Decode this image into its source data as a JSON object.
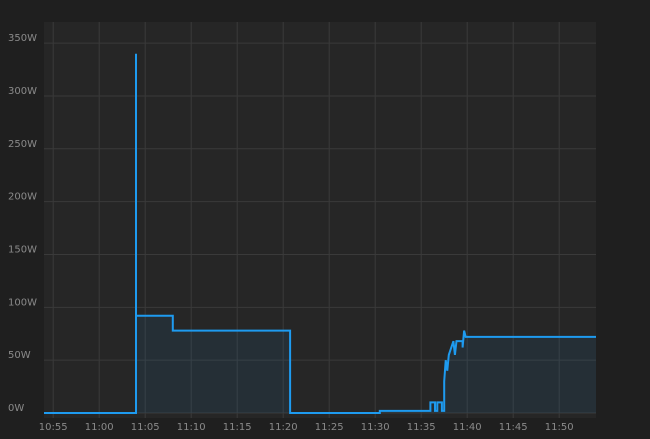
{
  "chart_data": {
    "type": "area",
    "title": "",
    "xlabel": "",
    "ylabel": "",
    "grid": true,
    "legend": "none",
    "x_ticks": [
      "10:55",
      "11:00",
      "11:05",
      "11:10",
      "11:15",
      "11:20",
      "11:25",
      "11:30",
      "11:35",
      "11:40",
      "11:45",
      "11:50"
    ],
    "y_ticks": [
      "0W",
      "50W",
      "100W",
      "150W",
      "200W",
      "250W",
      "300W",
      "350W"
    ],
    "xlim_minutes": [
      "10:54",
      "11:54"
    ],
    "ylim": [
      0,
      370
    ],
    "colors": {
      "line": "#1e9bf0",
      "fill": "rgba(30,155,240,0.08)",
      "grid": "#3a3a3a",
      "plot_bg": "#262626",
      "page_bg": "#1f1f1f",
      "ticks": "#8a8a8a"
    },
    "series": [
      {
        "points": [
          {
            "t": "10:54",
            "w": 0
          },
          {
            "t": "11:04",
            "w": 0
          },
          {
            "t": "11:04",
            "w": 340
          },
          {
            "t": "11:04",
            "w": 92
          },
          {
            "t": "11:08",
            "w": 92
          },
          {
            "t": "11:08",
            "w": 78
          },
          {
            "t": "11:20:45",
            "w": 78
          },
          {
            "t": "11:20:45",
            "w": 0
          },
          {
            "t": "11:30:30",
            "w": 0
          },
          {
            "t": "11:30:30",
            "w": 2
          },
          {
            "t": "11:36",
            "w": 2
          },
          {
            "t": "11:36",
            "w": 10
          },
          {
            "t": "11:36:30",
            "w": 10
          },
          {
            "t": "11:36:30",
            "w": 2
          },
          {
            "t": "11:36:45",
            "w": 2
          },
          {
            "t": "11:36:45",
            "w": 10
          },
          {
            "t": "11:37:15",
            "w": 10
          },
          {
            "t": "11:37:15",
            "w": 2
          },
          {
            "t": "11:37:30",
            "w": 2
          },
          {
            "t": "11:37:30",
            "w": 30
          },
          {
            "t": "11:37:40",
            "w": 50
          },
          {
            "t": "11:37:50",
            "w": 40
          },
          {
            "t": "11:38",
            "w": 55
          },
          {
            "t": "11:38:30",
            "w": 68
          },
          {
            "t": "11:38:40",
            "w": 55
          },
          {
            "t": "11:38:50",
            "w": 68
          },
          {
            "t": "11:39:30",
            "w": 68
          },
          {
            "t": "11:39:30",
            "w": 62
          },
          {
            "t": "11:39:40",
            "w": 78
          },
          {
            "t": "11:39:50",
            "w": 72
          },
          {
            "t": "11:54",
            "w": 72
          }
        ]
      }
    ]
  }
}
